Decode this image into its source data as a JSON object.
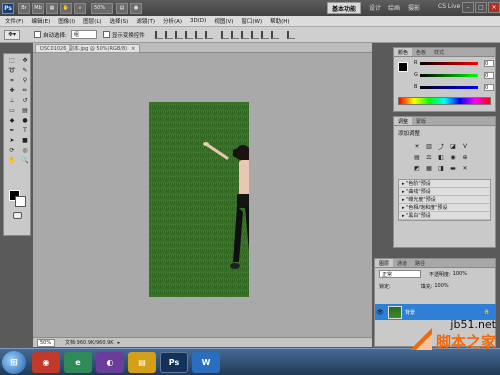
{
  "titlebar": {
    "app_logo": "Ps",
    "buttons": [
      "Br",
      "Mb"
    ],
    "zoom": "50%",
    "workspace": "基本功能",
    "workspace_links": [
      "设计",
      "绘画",
      "摄影"
    ],
    "cs_live": "CS Live"
  },
  "menu": [
    "文件(F)",
    "编辑(E)",
    "图像(I)",
    "图层(L)",
    "选择(S)",
    "滤镜(T)",
    "分析(A)",
    "3D(D)",
    "视图(V)",
    "窗口(W)",
    "帮助(H)"
  ],
  "options": {
    "auto_select_label": "自动选择:",
    "auto_select_value": "组",
    "show_transform_label": "显示变换控件"
  },
  "document": {
    "tab_title": "DSC01026_副本.jpg @ 50%(RGB/8)",
    "zoom": "50%",
    "doc_size": "文档:960.9K/960.9K"
  },
  "color_panel": {
    "tabs": [
      "颜色",
      "色板",
      "样式"
    ],
    "sliders": [
      {
        "letter": "R",
        "value": "0"
      },
      {
        "letter": "G",
        "value": "0"
      },
      {
        "letter": "B",
        "value": "0"
      }
    ]
  },
  "adjust_panel": {
    "tabs": [
      "调整",
      "蒙版"
    ],
    "title": "添加调整",
    "presets": [
      "\"色阶\"预设",
      "\"曲线\"预设",
      "\"曝光度\"预设",
      "\"色相/饱和度\"预设",
      "\"黑白\"预设"
    ]
  },
  "layers_panel": {
    "tabs": [
      "图层",
      "通道",
      "路径"
    ],
    "blend_mode": "正常",
    "opacity_label": "不透明度:",
    "opacity": "100%",
    "lock_label": "锁定:",
    "fill_label": "填充:",
    "fill": "100%",
    "layer_name": "背景"
  },
  "watermark": {
    "url": "jb51.net",
    "name": "脚本之家"
  },
  "colors": {
    "accent": "#2e7fd6",
    "grass": "#3f8a2c",
    "watermark_orange": "#f06a0b"
  }
}
